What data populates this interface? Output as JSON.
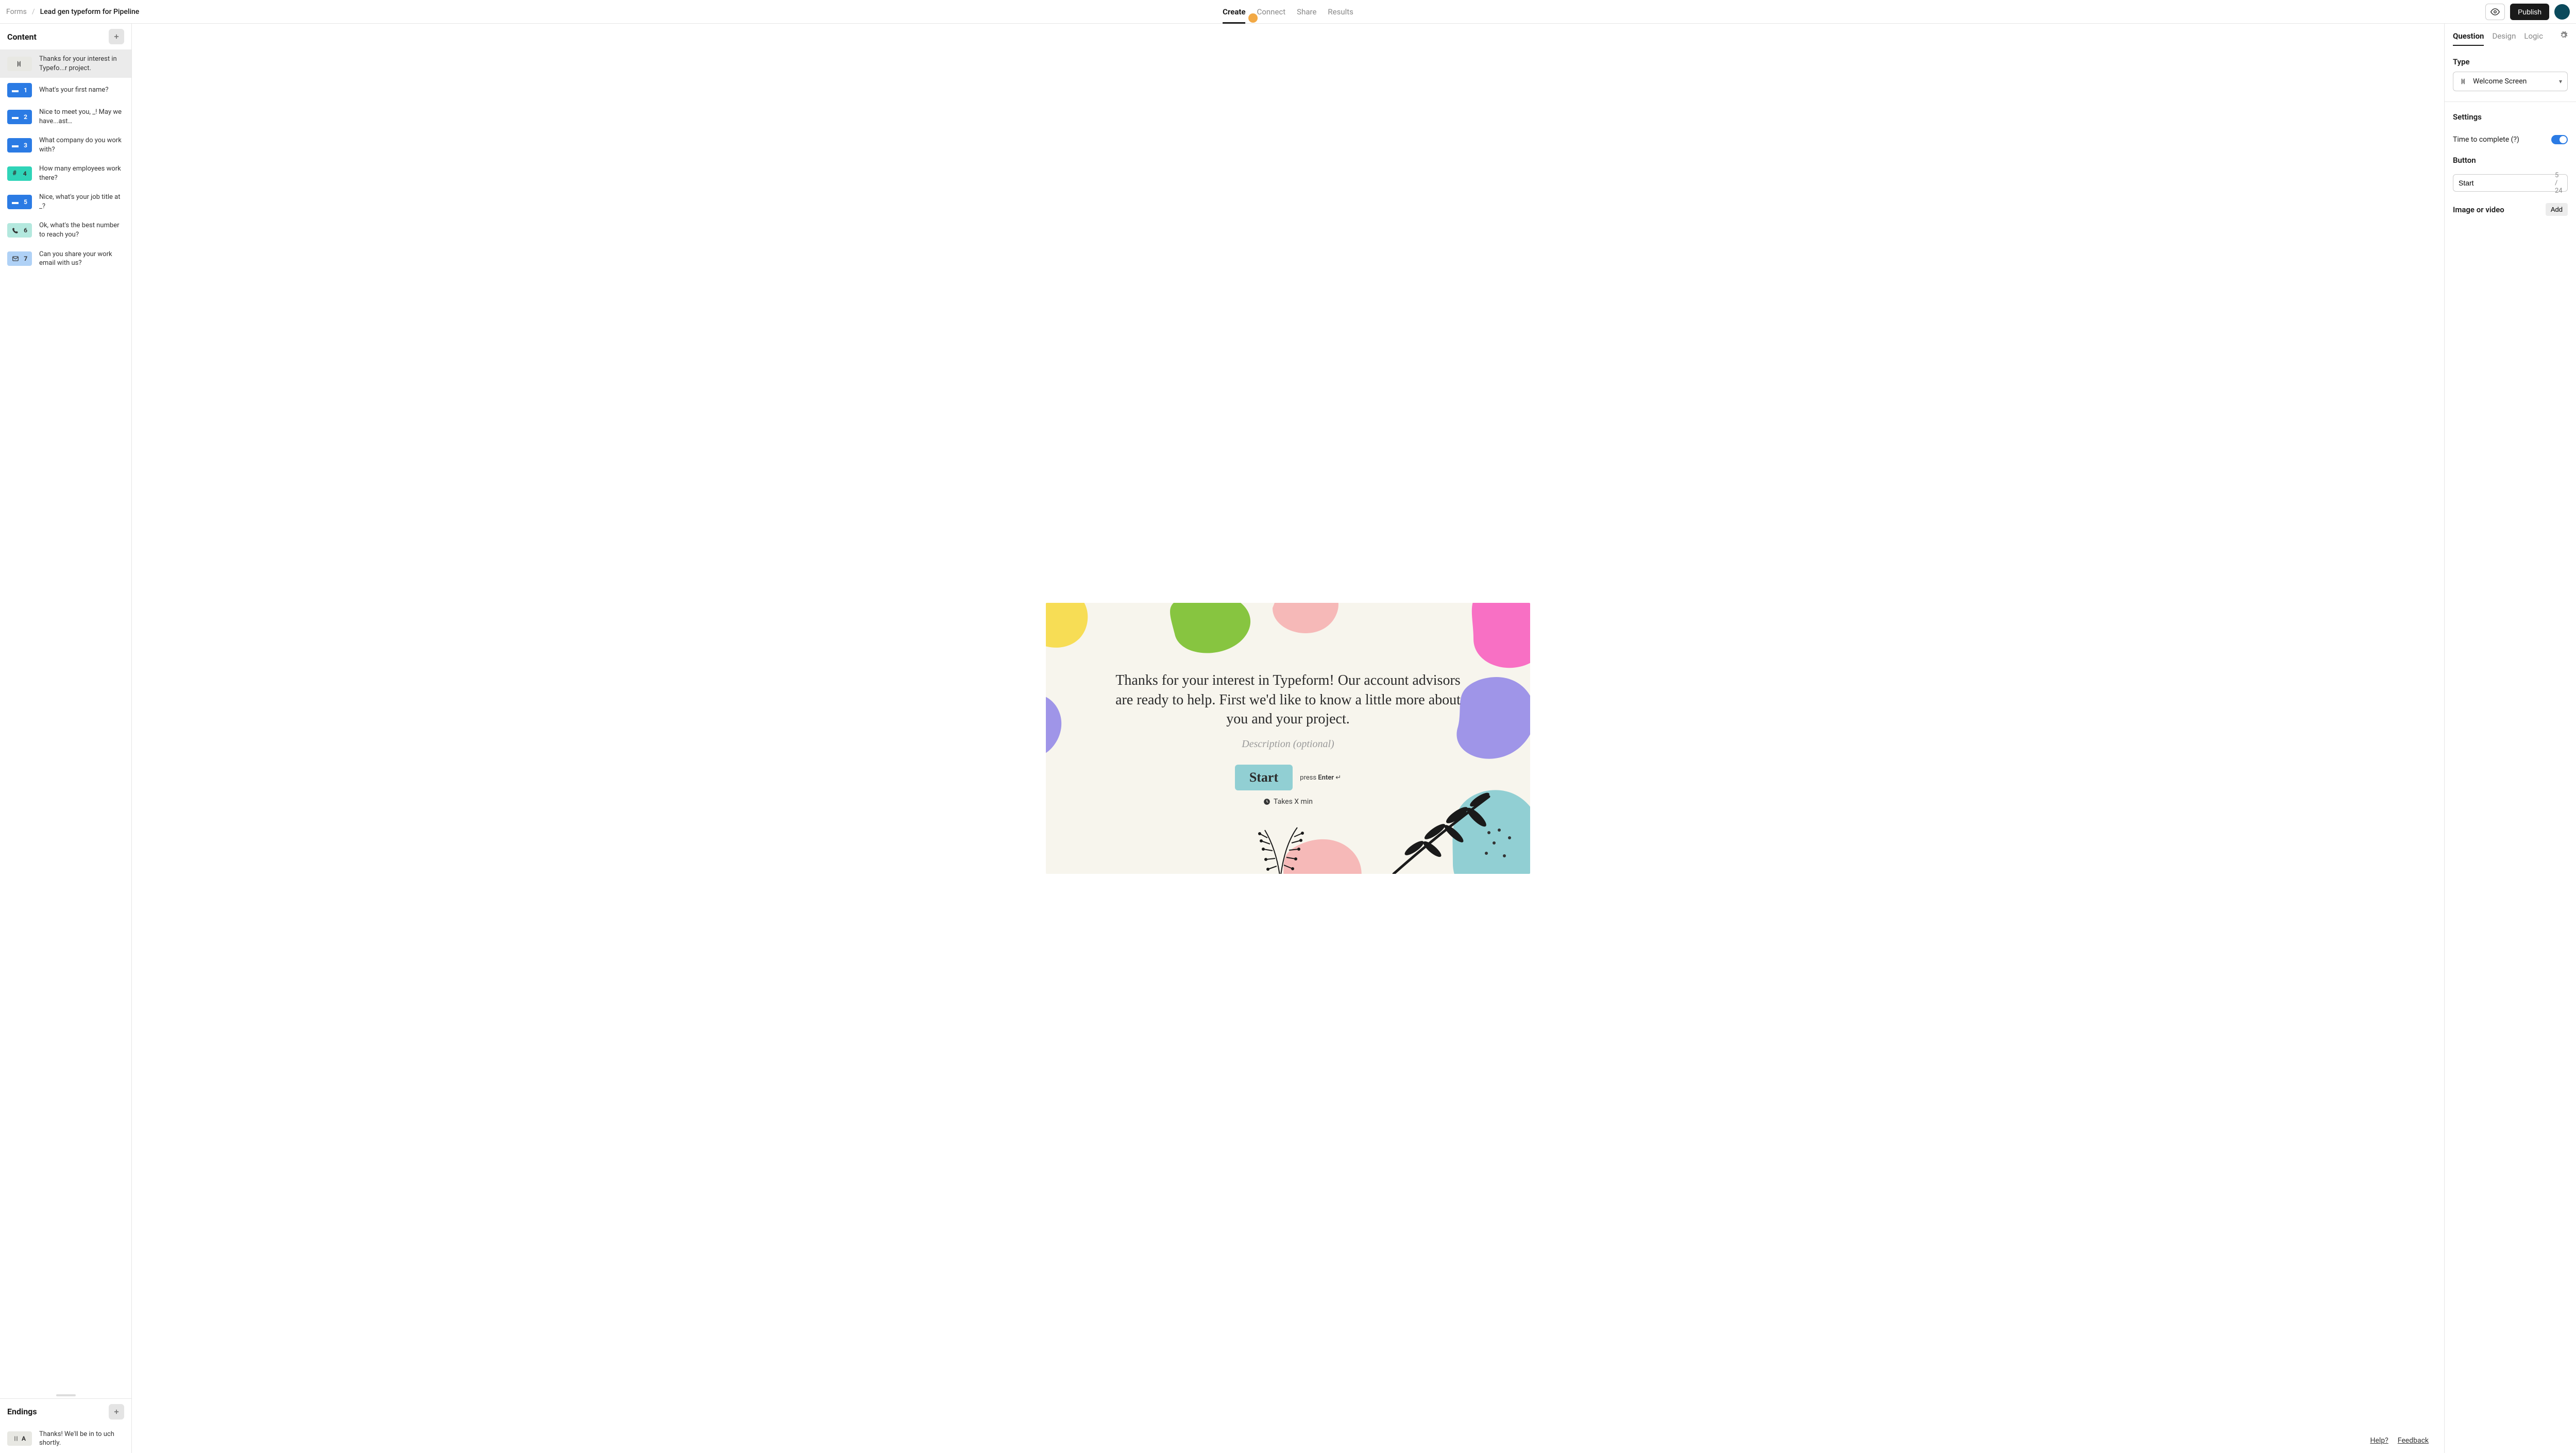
{
  "breadcrumb": {
    "root": "Forms",
    "title": "Lead gen typeform for Pipeline"
  },
  "header_tabs": {
    "create": "Create",
    "connect": "Connect",
    "share": "Share",
    "results": "Results"
  },
  "publish_label": "Publish",
  "left": {
    "content_heading": "Content",
    "endings_heading": "Endings",
    "items": [
      {
        "type": "welcome",
        "label": "Thanks for your interest in Typefo...r project."
      },
      {
        "type": "short-text",
        "num": "1",
        "label": "What's your first name?"
      },
      {
        "type": "short-text",
        "num": "2",
        "label": "Nice to meet you, _! May we have...ast…"
      },
      {
        "type": "short-text",
        "num": "3",
        "label": "What company do you work with?"
      },
      {
        "type": "number",
        "num": "4",
        "label": "How many employees work there?"
      },
      {
        "type": "short-text",
        "num": "5",
        "label": "Nice, what's your job title at _?"
      },
      {
        "type": "phone",
        "num": "6",
        "label": "Ok, what's the best number to reach you?"
      },
      {
        "type": "email",
        "num": "7",
        "label": "Can you share your work email with us?"
      }
    ],
    "endings": [
      {
        "letter": "A",
        "label": "Thanks! We'll be in to uch shortly."
      }
    ]
  },
  "canvas": {
    "title": "Thanks for your interest in Typeform! Our account advisors are ready to help. First we'd like to know a little more about you and your project.",
    "desc_placeholder": "Description (optional)",
    "button": "Start",
    "press_prefix": "press ",
    "press_key": "Enter",
    "time_text": "Takes X min"
  },
  "footer": {
    "help": "Help?",
    "feedback": "Feedback"
  },
  "right": {
    "tabs": {
      "question": "Question",
      "design": "Design",
      "logic": "Logic"
    },
    "type_label": "Type",
    "type_value": "Welcome Screen",
    "settings_label": "Settings",
    "time_setting": "Time to complete (?)",
    "button_label": "Button",
    "button_value": "Start",
    "button_counter": "5 / 24",
    "media_label": "Image or video",
    "add_label": "Add"
  }
}
